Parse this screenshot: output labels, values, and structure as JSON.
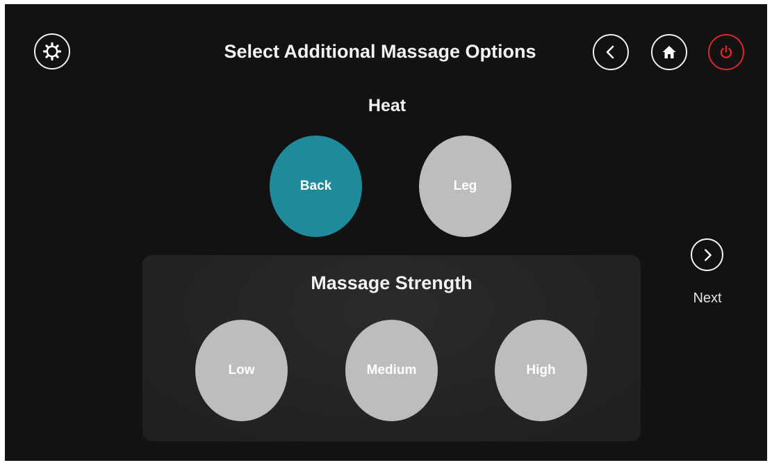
{
  "header": {
    "title": "Select Additional Massage Options",
    "settings_icon": "gear-icon",
    "back_icon": "chevron-left-icon",
    "home_icon": "home-icon",
    "power_icon": "power-icon"
  },
  "heat": {
    "title": "Heat",
    "options": [
      {
        "label": "Back",
        "selected": true
      },
      {
        "label": "Leg",
        "selected": false
      }
    ]
  },
  "strength": {
    "title": "Massage Strength",
    "options": [
      {
        "label": "Low",
        "selected": false
      },
      {
        "label": "Medium",
        "selected": false
      },
      {
        "label": "High",
        "selected": false
      }
    ]
  },
  "navigation": {
    "next_label": "Next",
    "next_icon": "chevron-right-icon"
  },
  "colors": {
    "background": "#121212",
    "selected": "#1f8a9a",
    "unselected": "#bdbdbd",
    "power": "#e0262a",
    "panel": "#262626"
  }
}
